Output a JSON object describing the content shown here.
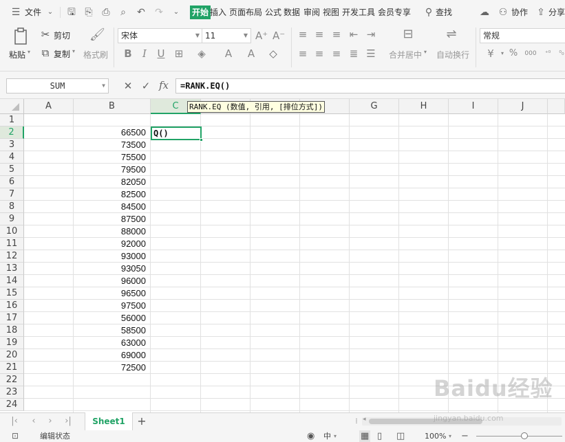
{
  "menubar": {
    "file_label": "文件",
    "tabs": [
      "开始",
      "插入",
      "页面布局",
      "公式",
      "数据",
      "审阅",
      "视图",
      "开发工具",
      "会员专享"
    ],
    "search_label": "查找",
    "collab_label": "协作",
    "share_label": "分享"
  },
  "ribbon": {
    "paste_label": "粘贴",
    "cut_label": "剪切",
    "copy_label": "复制",
    "format_painter_label": "格式刷",
    "font_name": "宋体",
    "font_size": "11",
    "merge_center_label": "合并居中",
    "wrap_text_label": "自动换行",
    "number_format": "常规",
    "currency_symbol": "¥",
    "percent_symbol": "%",
    "thousands_symbol": "000"
  },
  "formula_bar": {
    "name_box": "SUM",
    "fx_label": "fx",
    "formula": "=RANK.EQ()"
  },
  "grid": {
    "columns": [
      "A",
      "B",
      "C",
      "D",
      "E",
      "F",
      "G",
      "H",
      "I",
      "J"
    ],
    "rows": [
      "1",
      "2",
      "3",
      "4",
      "5",
      "6",
      "7",
      "8",
      "9",
      "10",
      "11",
      "12",
      "13",
      "14",
      "15",
      "16",
      "17",
      "18",
      "19",
      "20",
      "21",
      "22",
      "23",
      "24"
    ],
    "active_column": "C",
    "active_row": "2",
    "column_b_values": [
      "66500",
      "73500",
      "75500",
      "79500",
      "82050",
      "82500",
      "84500",
      "87500",
      "88000",
      "92000",
      "93000",
      "93050",
      "96000",
      "96500",
      "97500",
      "56000",
      "58500",
      "63000",
      "69000",
      "72500"
    ],
    "active_cell_text": "Q()",
    "tooltip": "RANK.EQ (数值, 引用, [排位方式])"
  },
  "sheets": {
    "tabs": [
      "Sheet1"
    ],
    "add_label": "+"
  },
  "status": {
    "mode": "编辑状态",
    "zoom": "100%",
    "input_method": "中"
  },
  "watermark": {
    "brand": "Baidu经验",
    "url": "jingyan.baidu.com"
  },
  "colors": {
    "accent": "#21a366",
    "tooltip_bg": "#ffffe1"
  }
}
